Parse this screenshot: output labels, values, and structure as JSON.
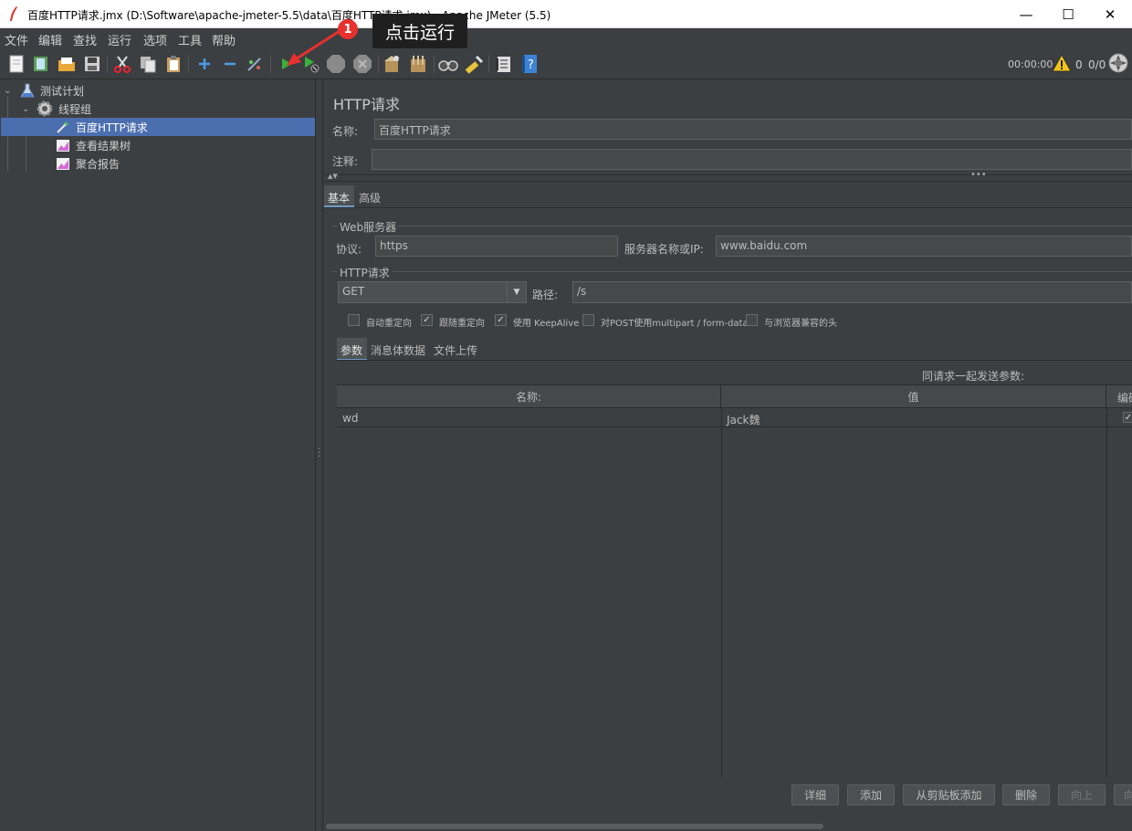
{
  "window": {
    "title": "百度HTTP请求.jmx (D:\\Software\\apache-jmeter-5.5\\data\\百度HTTP请求.jmx) - Apache JMeter (5.5)",
    "minimize": "—",
    "maximize": "☐",
    "close": "✕"
  },
  "menu": [
    "文件",
    "编辑",
    "查找",
    "运行",
    "选项",
    "工具",
    "帮助"
  ],
  "toolbar": {
    "timer": "00:00:00",
    "warnings": "0",
    "threads": "0/0",
    "icons": [
      "new-icon",
      "templates-icon",
      "open-icon",
      "save-icon",
      "cut-icon",
      "copy-icon",
      "paste-icon",
      "expand-icon",
      "collapse-icon",
      "toggle-icon",
      "start-icon",
      "start-no-pauses-icon",
      "stop-icon",
      "shutdown-icon",
      "clear-icon",
      "clear-all-icon",
      "search-icon",
      "reset-search-icon",
      "function-helper-icon",
      "help-icon"
    ]
  },
  "annotation": {
    "badge": "1",
    "text": "点击运行"
  },
  "tree": {
    "nodes": [
      {
        "label": "测试计划",
        "icon": "flask-icon"
      },
      {
        "label": "线程组",
        "icon": "gear-icon"
      },
      {
        "label": "百度HTTP请求",
        "icon": "pipette-icon",
        "selected": true
      },
      {
        "label": "查看结果树",
        "icon": "chart-icon"
      },
      {
        "label": "聚合报告",
        "icon": "chart-icon"
      }
    ]
  },
  "panel": {
    "heading": "HTTP请求",
    "name_label": "名称:",
    "name_value": "百度HTTP请求",
    "comment_label": "注释:",
    "comment_value": "",
    "tabs": [
      "基本",
      "高级"
    ],
    "web_server_group": "Web服务器",
    "protocol_label": "协议:",
    "protocol_value": "https",
    "server_label": "服务器名称或IP:",
    "server_value": "www.baidu.com",
    "http_group": "HTTP请求",
    "method": "GET",
    "path_label": "路径:",
    "path_value": "/s",
    "checkboxes": [
      {
        "label": "自动重定向",
        "checked": false
      },
      {
        "label": "跟随重定向",
        "checked": true
      },
      {
        "label": "使用 KeepAlive",
        "checked": true
      },
      {
        "label": "对POST使用multipart / form-data",
        "checked": false
      },
      {
        "label": "与浏览器兼容的头",
        "checked": false
      }
    ],
    "sub_tabs": [
      "参数",
      "消息体数据",
      "文件上传"
    ],
    "params_caption": "同请求一起发送参数:",
    "columns": [
      "名称:",
      "值",
      "编码"
    ],
    "rows": [
      {
        "name": "wd",
        "value": "Jack魏",
        "encode": true
      }
    ],
    "buttons": [
      "详细",
      "添加",
      "从剪贴板添加",
      "删除",
      "向上",
      "向下"
    ]
  }
}
